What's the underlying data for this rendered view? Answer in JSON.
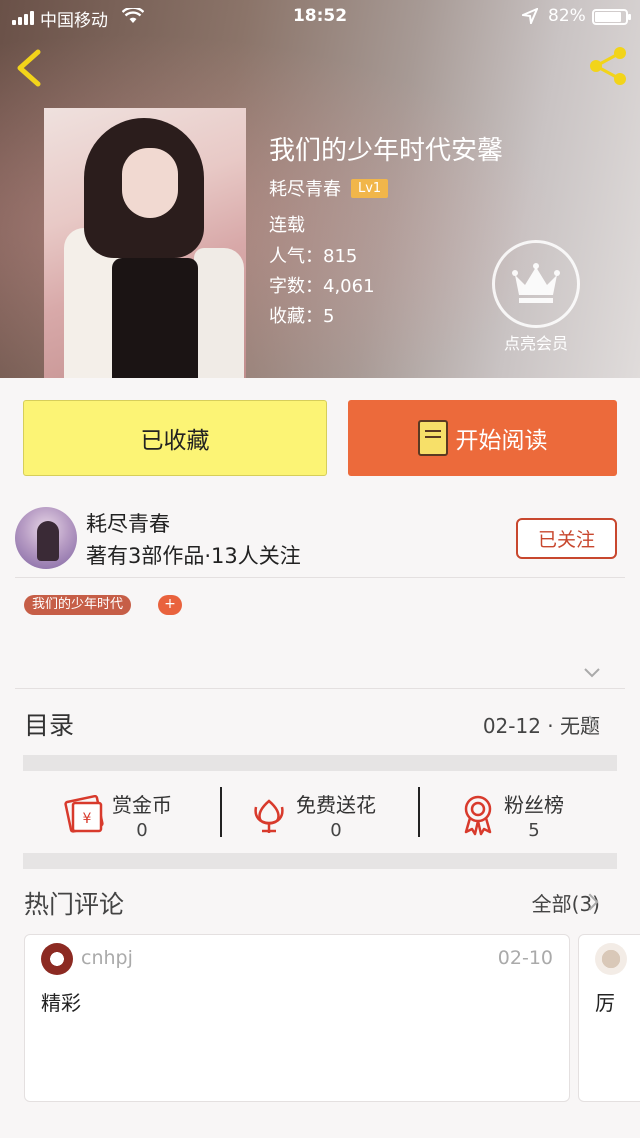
{
  "status_bar": {
    "carrier": "中国移动",
    "time": "18:52",
    "battery": "82%"
  },
  "book": {
    "title": "我们的少年时代安馨",
    "author": "耗尽青春",
    "level": "Lv1",
    "status": "连载",
    "popularity_label": "人气：",
    "popularity": "815",
    "words_label": "字数：",
    "words": "4,061",
    "favorites_label": "收藏：",
    "favorites": "5"
  },
  "vip": {
    "label": "点亮会员"
  },
  "actions": {
    "favorite_label": "已收藏",
    "read_label": "开始阅读"
  },
  "author": {
    "name": "耗尽青春",
    "stats": "著有3部作品·13人关注",
    "follow_label": "已关注"
  },
  "tags": {
    "items": [
      "我们的少年时代"
    ],
    "add": "+"
  },
  "catalog": {
    "label": "目录",
    "latest": "02-12 · 无题"
  },
  "stats": [
    {
      "label": "赏金币",
      "value": "0",
      "icon": "red-envelope-icon"
    },
    {
      "label": "免费送花",
      "value": "0",
      "icon": "flower-icon"
    },
    {
      "label": "粉丝榜",
      "value": "5",
      "icon": "medal-icon"
    }
  ],
  "comments": {
    "label": "热门评论",
    "all_link": "全部(3)",
    "items": [
      {
        "user": "cnhpj",
        "date": "02-10",
        "text": "精彩"
      },
      {
        "user": "",
        "date": "",
        "text": "厉"
      }
    ]
  },
  "colors": {
    "favorite_bg": "#fcf475",
    "read_bg": "#ec6a3b",
    "follow_border": "#c8472e",
    "lv_badge": "#f1b64a"
  }
}
